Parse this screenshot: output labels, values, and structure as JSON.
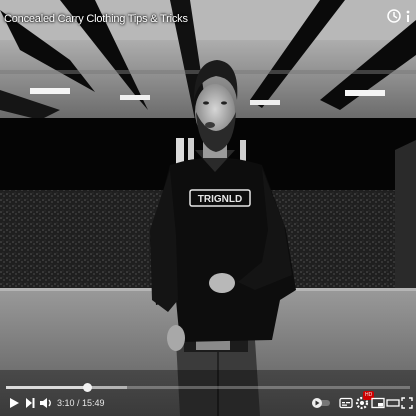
{
  "video": {
    "title": "Concealed Carry Clothing Tips & Tricks",
    "shirt_text": "TRIGNLD"
  },
  "player": {
    "progress": 0.2,
    "buffered": 0.3,
    "current_time": "3:10",
    "duration": "15:49",
    "time_display": "3:10 / 15:49"
  },
  "controls": {
    "left": [
      "play-icon",
      "next-icon",
      "volume-icon"
    ],
    "right": [
      "autoplay-toggle-icon",
      "subtitles-icon",
      "settings-icon",
      "miniplayer-icon",
      "theater-icon",
      "fullscreen-icon"
    ],
    "hd_badge": "HD"
  },
  "colors": {
    "progress": "#dcdcdc",
    "text": "#ffffff"
  }
}
